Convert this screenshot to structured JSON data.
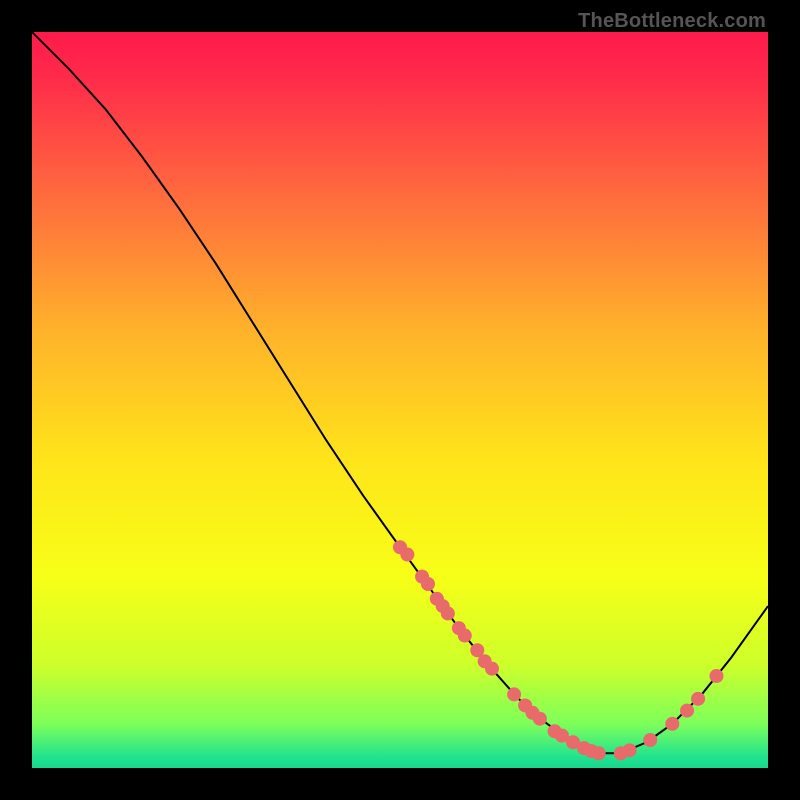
{
  "watermark": "TheBottleneck.com",
  "chart_data": {
    "type": "line",
    "title": "",
    "xlabel": "",
    "ylabel": "",
    "xlim": [
      0,
      100
    ],
    "ylim": [
      0,
      100
    ],
    "grid": false,
    "legend": false,
    "background_gradient_stops": [
      {
        "offset": 0.0,
        "color": "#ff1a4b"
      },
      {
        "offset": 0.06,
        "color": "#ff2a4a"
      },
      {
        "offset": 0.22,
        "color": "#ff6a3e"
      },
      {
        "offset": 0.4,
        "color": "#ffb02b"
      },
      {
        "offset": 0.58,
        "color": "#ffe41a"
      },
      {
        "offset": 0.74,
        "color": "#f7ff17"
      },
      {
        "offset": 0.86,
        "color": "#cdff2a"
      },
      {
        "offset": 0.94,
        "color": "#7dff5a"
      },
      {
        "offset": 0.985,
        "color": "#20e38f"
      },
      {
        "offset": 1.0,
        "color": "#17d88b"
      }
    ],
    "series": [
      {
        "name": "curve",
        "color": "#000000",
        "stroke_width": 2,
        "x": [
          0,
          5,
          10,
          15,
          20,
          25,
          30,
          35,
          40,
          45,
          50,
          54,
          58,
          62,
          66,
          70,
          73.5,
          76.5,
          80,
          83.5,
          87,
          91,
          95,
          100
        ],
        "y": [
          100,
          95,
          89.5,
          83,
          76,
          68.5,
          60.5,
          52.5,
          44.5,
          37,
          30,
          24.5,
          19,
          14,
          9.5,
          6,
          3.5,
          2,
          2,
          3.5,
          6,
          10,
          15,
          22
        ]
      }
    ],
    "scatter": {
      "name": "markers",
      "color": "#e86a6a",
      "radius": 7,
      "points": [
        {
          "x": 50.0,
          "y": 30.0
        },
        {
          "x": 51.0,
          "y": 29.0
        },
        {
          "x": 53.0,
          "y": 26.0
        },
        {
          "x": 53.8,
          "y": 25.0
        },
        {
          "x": 55.0,
          "y": 23.0
        },
        {
          "x": 55.8,
          "y": 22.0
        },
        {
          "x": 56.5,
          "y": 21.0
        },
        {
          "x": 58.0,
          "y": 19.0
        },
        {
          "x": 58.8,
          "y": 18.0
        },
        {
          "x": 60.5,
          "y": 16.0
        },
        {
          "x": 61.5,
          "y": 14.5
        },
        {
          "x": 62.5,
          "y": 13.5
        },
        {
          "x": 65.5,
          "y": 10.0
        },
        {
          "x": 67.0,
          "y": 8.5
        },
        {
          "x": 68.0,
          "y": 7.5
        },
        {
          "x": 69.0,
          "y": 6.7
        },
        {
          "x": 71.0,
          "y": 5.0
        },
        {
          "x": 72.0,
          "y": 4.4
        },
        {
          "x": 73.5,
          "y": 3.5
        },
        {
          "x": 75.0,
          "y": 2.7
        },
        {
          "x": 76.0,
          "y": 2.3
        },
        {
          "x": 77.0,
          "y": 2.0
        },
        {
          "x": 80.0,
          "y": 2.0
        },
        {
          "x": 81.2,
          "y": 2.4
        },
        {
          "x": 84.0,
          "y": 3.8
        },
        {
          "x": 87.0,
          "y": 6.0
        },
        {
          "x": 89.0,
          "y": 7.8
        },
        {
          "x": 90.5,
          "y": 9.4
        },
        {
          "x": 93.0,
          "y": 12.5
        }
      ]
    }
  }
}
